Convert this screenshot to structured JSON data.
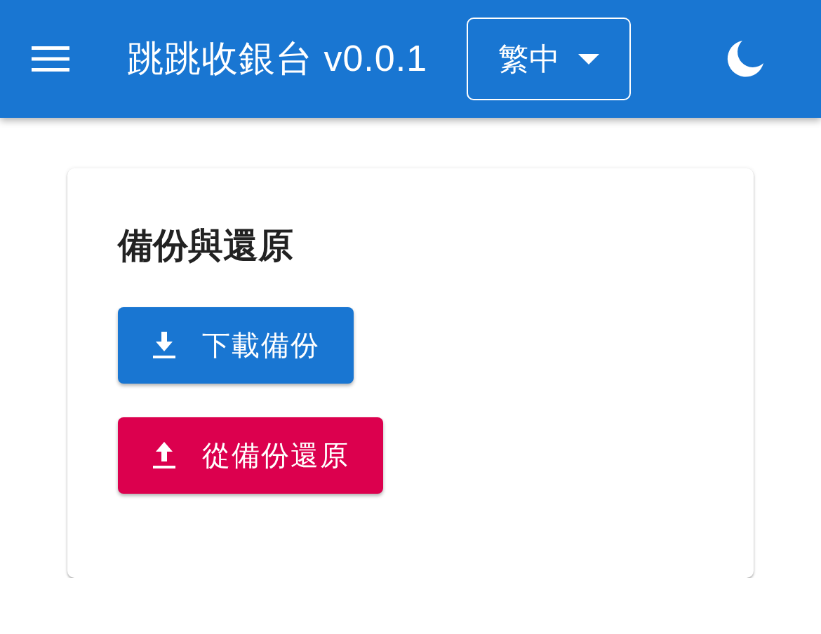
{
  "app_bar": {
    "title": "跳跳收銀台 v0.0.1",
    "language_select": {
      "value": "繁中"
    }
  },
  "card": {
    "title": "備份與還原",
    "buttons": [
      {
        "kind": "download",
        "label": "下載備份"
      },
      {
        "kind": "upload",
        "label": "從備份還原"
      }
    ]
  }
}
